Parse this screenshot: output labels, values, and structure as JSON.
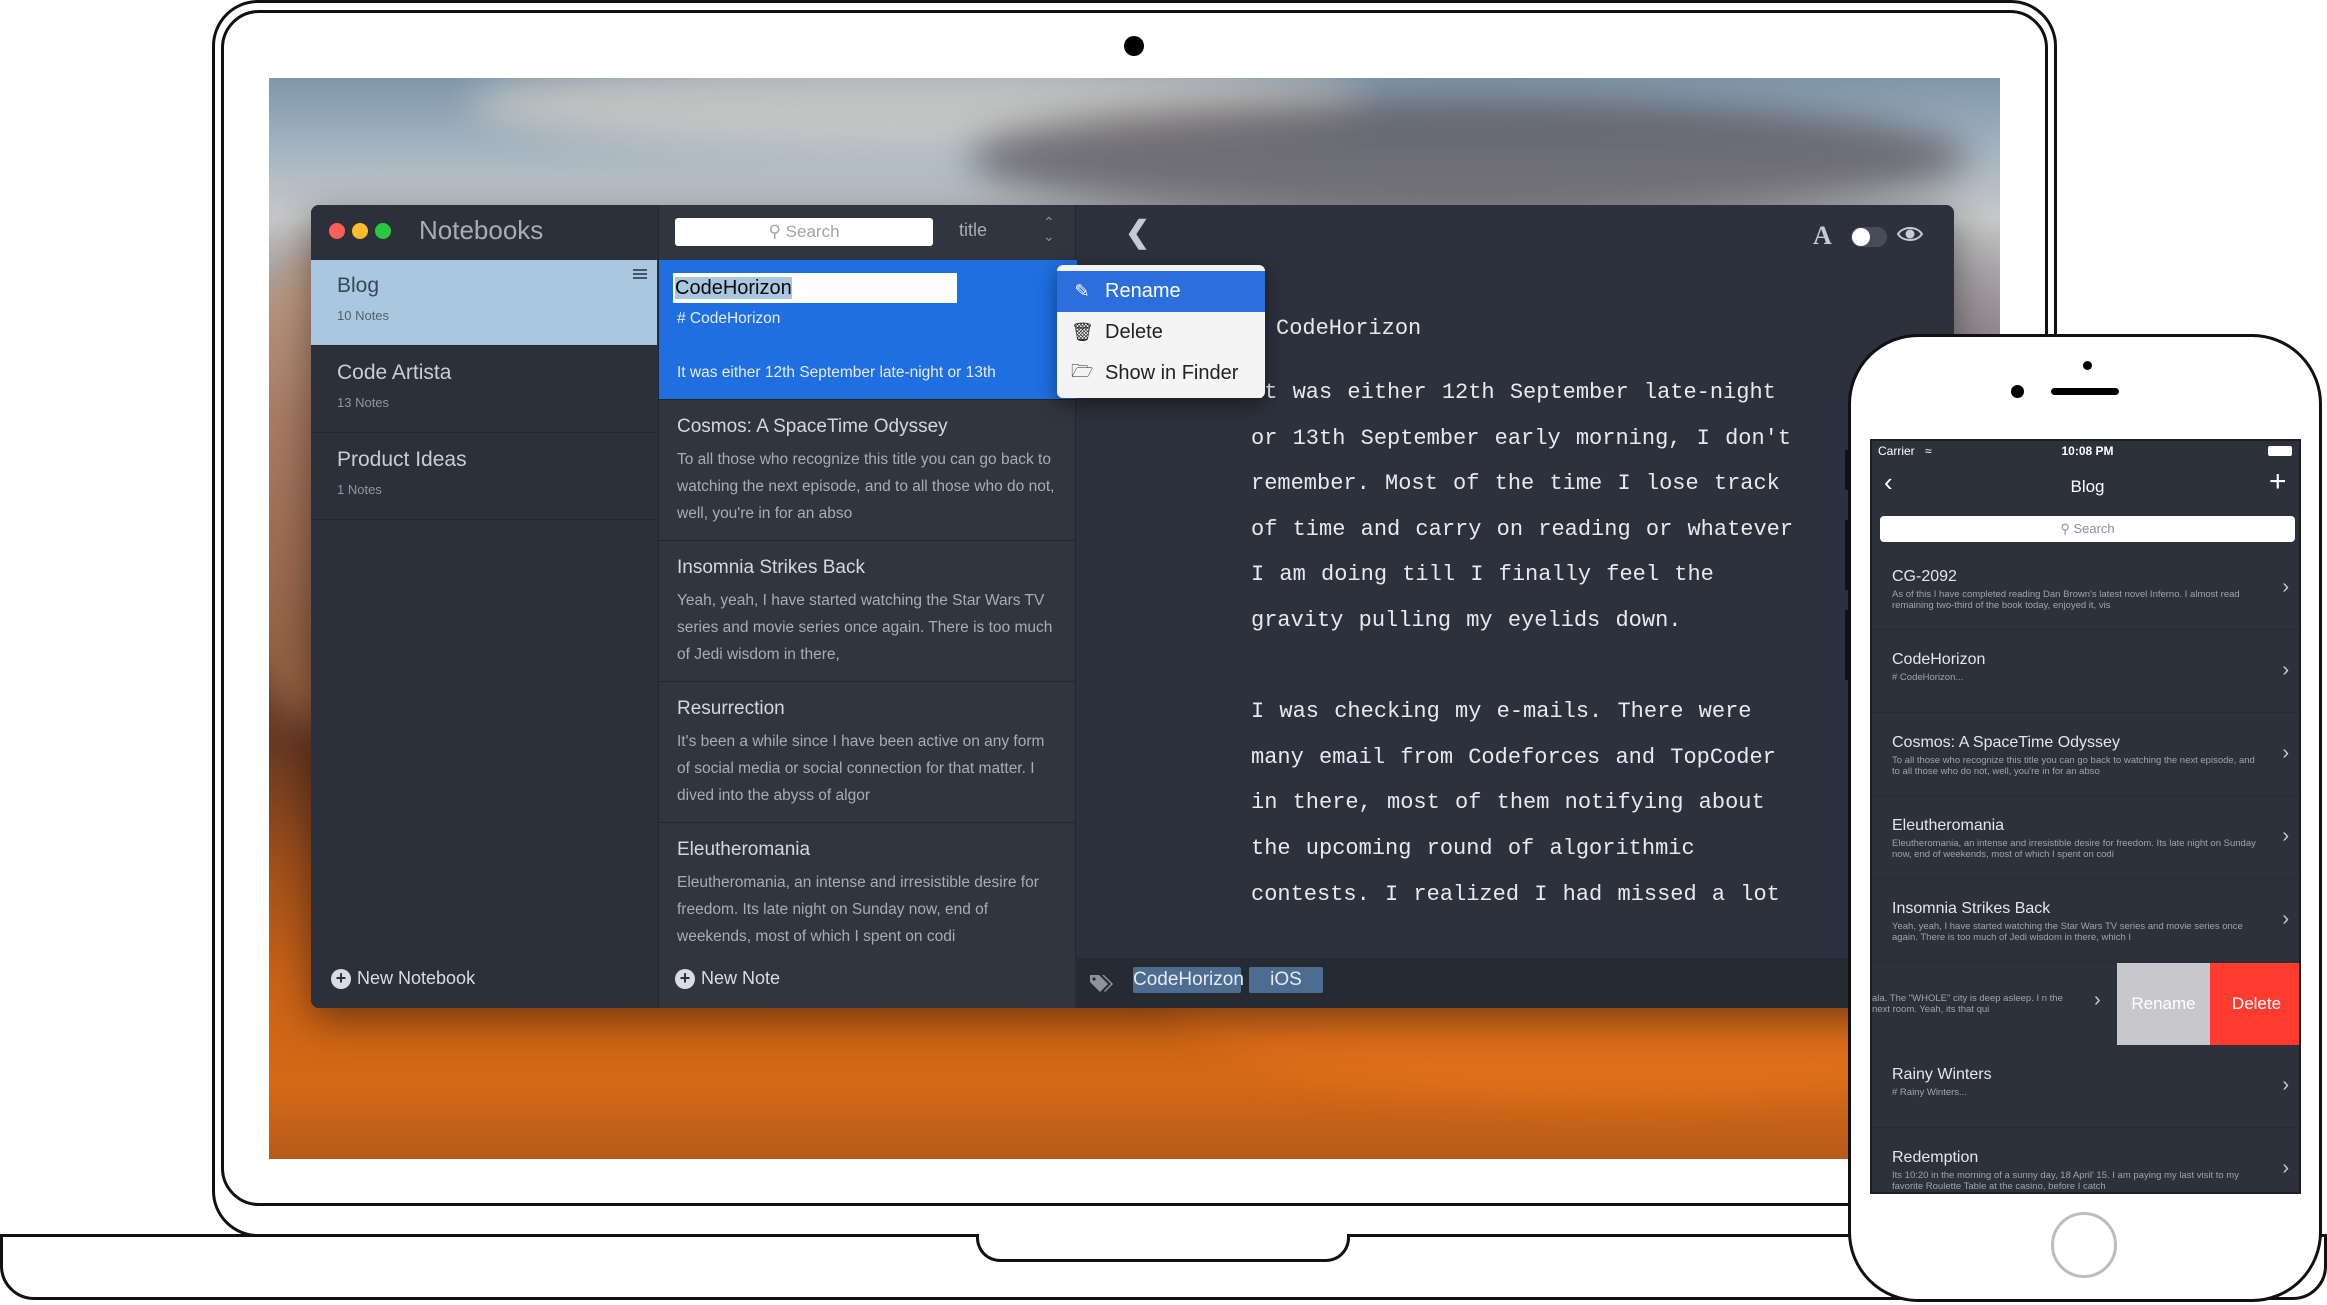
{
  "mac_app": {
    "window_title": "Notebooks",
    "notebooks": [
      {
        "name": "Blog",
        "count": "10 Notes"
      },
      {
        "name": "Code Artista",
        "count": "13 Notes"
      },
      {
        "name": "Product Ideas",
        "count": "1 Notes"
      }
    ],
    "new_notebook_label": "New Notebook",
    "search_placeholder": "Search",
    "sort_by": "title",
    "selected_note": {
      "title": "CodeHorizon",
      "line1": "# CodeHorizon",
      "line2": "It was either 12th September late-night or 13th"
    },
    "notes": [
      {
        "title": "Cosmos: A SpaceTime Odyssey",
        "body": "To all those who recognize this title you can go back to watching the next episode, and to all those who do not, well, you're in for an abso"
      },
      {
        "title": "Insomnia Strikes Back",
        "body": "Yeah, yeah, I have started watching the Star Wars TV series and movie series once again. There is too much of Jedi wisdom in there,"
      },
      {
        "title": "Resurrection",
        "body": "It's been a while since I have been active on any form of social media or social connection for that matter. I dived into the abyss of algor"
      },
      {
        "title": "Eleutheromania",
        "body": "Eleutheromania, an intense and irresistible desire for freedom. Its late night on Sunday now, end of weekends, most of which I spent on codi"
      }
    ],
    "new_note_label": "New Note",
    "context_menu": {
      "rename": "Rename",
      "delete": "Delete",
      "show_in_finder": "Show in Finder"
    },
    "editor": {
      "heading": "CodeHorizon",
      "lines": [
        "It was either 12th September late-night",
        "or 13th September early morning, I don't",
        "remember. Most of the time I lose track",
        "of time and carry on reading or whatever",
        "I am doing till I finally feel the",
        "gravity pulling my eyelids down.",
        "",
        "I was checking my e-mails. There were",
        "many email from Codeforces and TopCoder",
        "in there, most of them notifying about",
        "the upcoming round of algorithmic",
        "contests. I realized I had missed a lot"
      ],
      "font_icon": "A",
      "tags": [
        "CodeHorizon",
        "iOS"
      ]
    },
    "colors": {
      "selected_notebook": "#a9c8e0",
      "selected_note": "#1f6fe0",
      "menu_highlight": "#2c6fdc"
    }
  },
  "ios_app": {
    "carrier": "Carrier",
    "time": "10:08 PM",
    "title": "Blog",
    "search_placeholder": "Search",
    "rows": [
      {
        "title": "CG-2092",
        "sub": "As of this   I have completed reading Dan Brown's latest novel Inferno. I almost read remaining two-third of the book today, enjoyed it, vis"
      },
      {
        "title": "CodeHorizon",
        "sub": "# CodeHorizon..."
      },
      {
        "title": "Cosmos: A SpaceTime Odyssey",
        "sub": "To all those who recognize this title you can go back to watching the next episode, and to all those who do not, well, you're in for an abso"
      },
      {
        "title": "Eleutheromania",
        "sub": "Eleutheromania, an intense and irresistible desire for freedom. Its late night on Sunday now, end of weekends, most of which I spent on codi"
      },
      {
        "title": "Insomnia Strikes Back",
        "sub": "Yeah, yeah, I have started watching the Star Wars TV series and movie series once again. There is too much of Jedi wisdom in there, which I"
      },
      {
        "title": "",
        "sub": "ala. The \"WHOLE\" city is deep asleep. I n the next room. Yeah, its that qui"
      },
      {
        "title": "Rainy Winters",
        "sub": "# Rainy Winters..."
      },
      {
        "title": "Redemption",
        "sub": "Its 10:20 in the morning of a sunny day, 18 April' 15. I am paying my last visit to my favorite Roulette Table at the casino, before I catch"
      }
    ],
    "swipe_actions": {
      "rename": "Rename",
      "delete": "Delete"
    },
    "colors": {
      "rename": "#c7c7cc",
      "delete": "#ff3b30"
    }
  }
}
